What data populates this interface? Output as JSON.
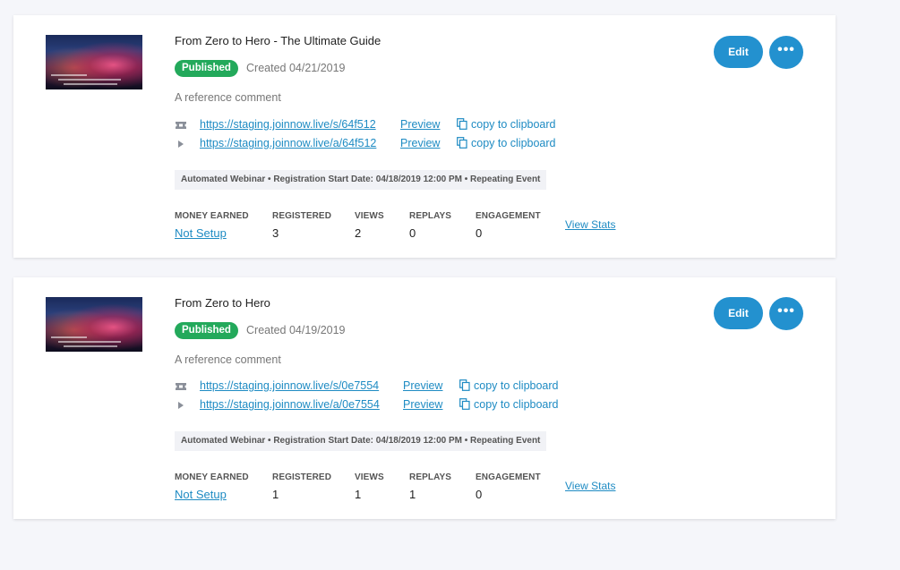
{
  "colors": {
    "accent": "#2391cf",
    "link": "#1e8bc3",
    "published": "#23a95b",
    "background": "#f5f6fa"
  },
  "events": [
    {
      "title": "From Zero to Hero - The Ultimate Guide",
      "status": "Published",
      "created": "Created 04/21/2019",
      "comment": "A reference comment",
      "links": [
        {
          "icon": "ticket-icon",
          "url": "https://staging.joinnow.live/s/64f512",
          "preview": "Preview",
          "copy": "copy to clipboard"
        },
        {
          "icon": "play-icon",
          "url": "https://staging.joinnow.live/a/64f512",
          "preview": "Preview",
          "copy": "copy to clipboard"
        }
      ],
      "info": "Automated Webinar • Registration Start Date: 04/18/2019 12:00 PM • Repeating Event",
      "stats": {
        "money_label": "MONEY EARNED",
        "money_value": "Not Setup",
        "registered_label": "REGISTERED",
        "registered_value": "3",
        "views_label": "VIEWS",
        "views_value": "2",
        "replays_label": "REPLAYS",
        "replays_value": "0",
        "engagement_label": "ENGAGEMENT",
        "engagement_value": "0",
        "view_stats": "View Stats"
      },
      "edit": "Edit",
      "more": "•••"
    },
    {
      "title": "From Zero to Hero",
      "status": "Published",
      "created": "Created 04/19/2019",
      "comment": "A reference comment",
      "links": [
        {
          "icon": "ticket-icon",
          "url": "https://staging.joinnow.live/s/0e7554",
          "preview": "Preview",
          "copy": "copy to clipboard"
        },
        {
          "icon": "play-icon",
          "url": "https://staging.joinnow.live/a/0e7554",
          "preview": "Preview",
          "copy": "copy to clipboard"
        }
      ],
      "info": "Automated Webinar • Registration Start Date: 04/18/2019 12:00 PM • Repeating Event",
      "stats": {
        "money_label": "MONEY EARNED",
        "money_value": "Not Setup",
        "registered_label": "REGISTERED",
        "registered_value": "1",
        "views_label": "VIEWS",
        "views_value": "1",
        "replays_label": "REPLAYS",
        "replays_value": "1",
        "engagement_label": "ENGAGEMENT",
        "engagement_value": "0",
        "view_stats": "View Stats"
      },
      "edit": "Edit",
      "more": "•••"
    }
  ]
}
